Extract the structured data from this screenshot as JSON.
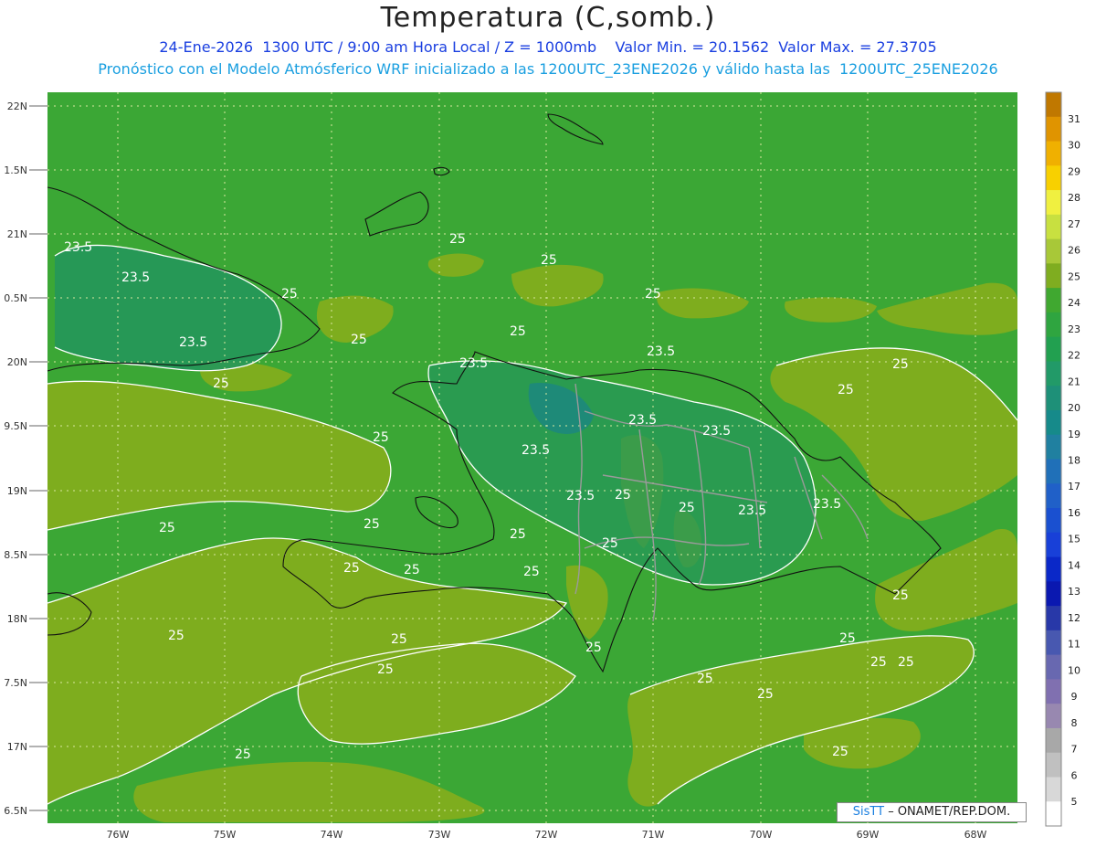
{
  "header": {
    "title": "Temperatura (C,somb.)",
    "line1": "24-Ene-2026  1300 UTC / 9:00 am Hora Local / Z = 1000mb    Valor Min. = 20.1562  Valor Max. = 27.3705",
    "line2": "Pronóstico con el Modelo Atmósferico WRF inicializado a las 1200UTC_23ENE2026 y válido hasta las  1200UTC_25ENE2026"
  },
  "axes": {
    "lat_labels": [
      "22N",
      "1.5N",
      "21N",
      "0.5N",
      "20N",
      "9.5N",
      "19N",
      "8.5N",
      "18N",
      "7.5N",
      "17N",
      "6.5N"
    ],
    "lon_labels": [
      "76W",
      "75W",
      "74W",
      "73W",
      "72W",
      "71W",
      "70W",
      "69W",
      "68W"
    ]
  },
  "contour_labels": {
    "c1": "23.5",
    "c2": "23.5",
    "c3": "23.5",
    "c4": "23.5",
    "c5": "23.5",
    "c6": "23.5",
    "c7": "23.5",
    "c8": "23.5",
    "c9": "23.5",
    "c10": "23.5",
    "c11": "23.5",
    "d1": "25",
    "d2": "25",
    "d3": "25",
    "d4": "25",
    "d5": "25",
    "d6": "25",
    "d7": "25",
    "d8": "25",
    "d9": "25",
    "d10": "25",
    "d11": "25",
    "d12": "25",
    "d13": "25",
    "d14": "25",
    "d15": "25",
    "d16": "25",
    "d17": "25",
    "d18": "25",
    "d19": "25",
    "d20": "25",
    "d21": "25",
    "d22": "25",
    "d23": "25",
    "d24": "25",
    "d25": "25",
    "d26": "25",
    "d27": "25",
    "d28": "25",
    "d29": "25",
    "d30": "25",
    "d31": "25"
  },
  "colorbar": {
    "labels": [
      "31",
      "30",
      "29",
      "28",
      "27",
      "26",
      "25",
      "24",
      "23",
      "22",
      "21",
      "20",
      "19",
      "18",
      "17",
      "16",
      "15",
      "14",
      "13",
      "12",
      "11",
      "10",
      "9",
      "8",
      "7",
      "6",
      "5"
    ],
    "colors": [
      "#c07800",
      "#e09400",
      "#f0b000",
      "#f8d000",
      "#f0f040",
      "#c8e040",
      "#a8c838",
      "#7fad20",
      "#40a830",
      "#2fa540",
      "#22a050",
      "#229a68",
      "#1e9078",
      "#168a8a",
      "#2080a0",
      "#2070b8",
      "#2060c8",
      "#1a50d0",
      "#1840d8",
      "#0a28c8",
      "#0a18b0",
      "#2838a8",
      "#4858b0",
      "#6868b0",
      "#8070b0",
      "#9888b0",
      "#a8a8a8",
      "#c0c0c0",
      "#d8d8d8",
      "#ffffff"
    ]
  },
  "credit": {
    "brand": "SisTT",
    "text": " – ONAMET/REP.DOM."
  }
}
